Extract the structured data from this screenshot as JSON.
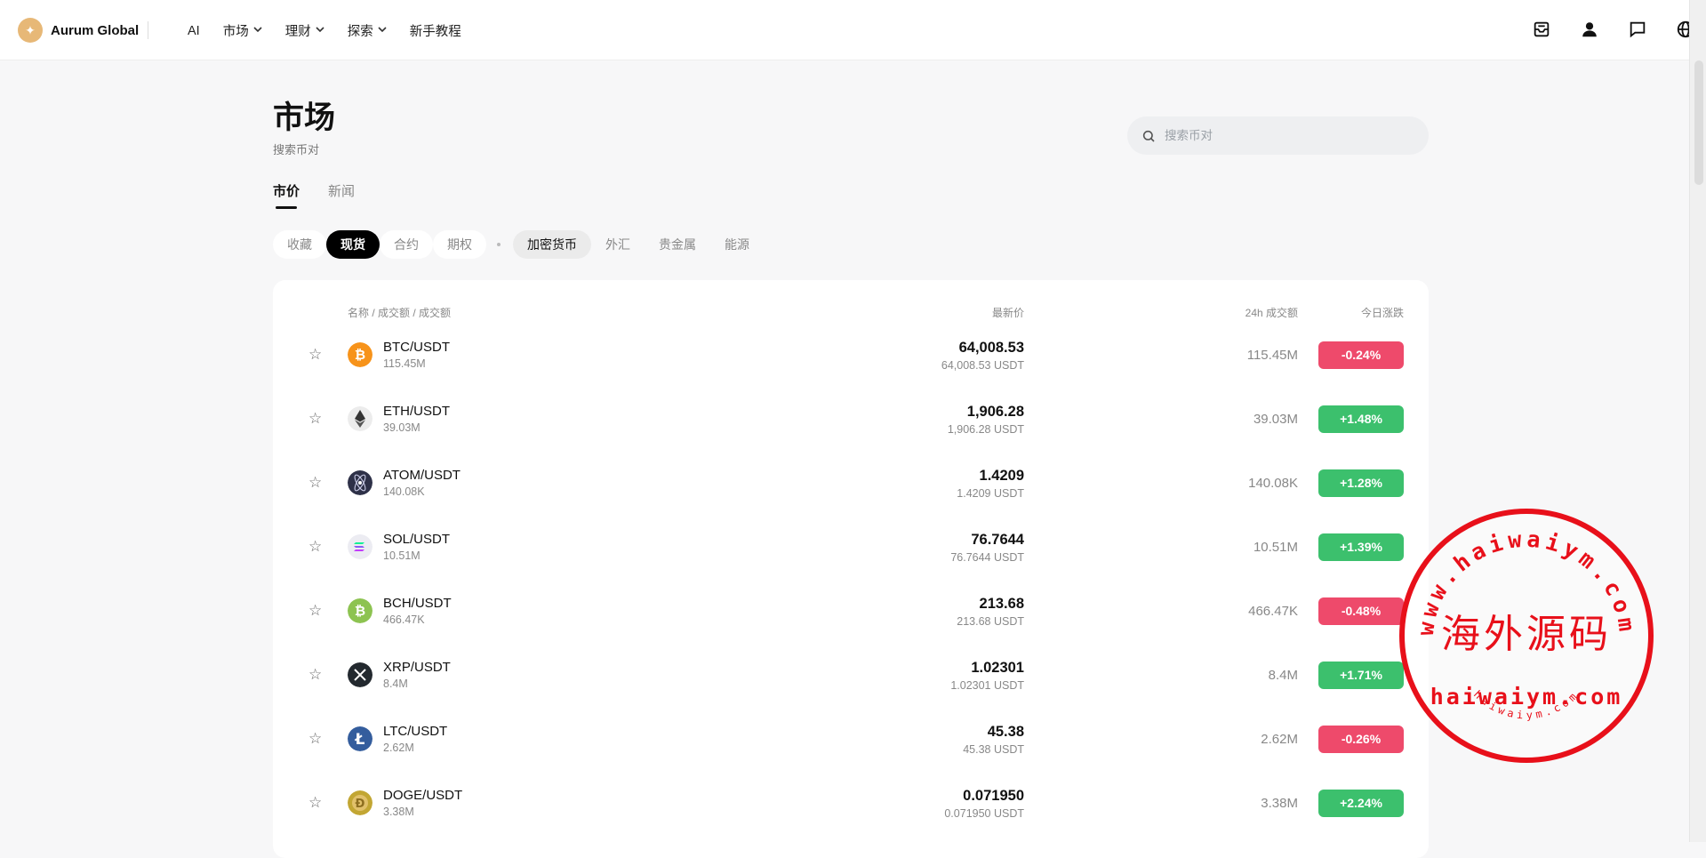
{
  "brand": {
    "name": "Aurum Global"
  },
  "nav": {
    "items": [
      {
        "label": "AI",
        "dropdown": false
      },
      {
        "label": "市场",
        "dropdown": true
      },
      {
        "label": "理财",
        "dropdown": true
      },
      {
        "label": "探索",
        "dropdown": true
      },
      {
        "label": "新手教程",
        "dropdown": false
      }
    ],
    "right_icons": [
      "inbox-icon",
      "user-icon",
      "chat-icon",
      "globe-icon"
    ]
  },
  "page": {
    "title": "市场",
    "subtitle": "搜索币对"
  },
  "search": {
    "placeholder": "搜索币对"
  },
  "tabs": [
    {
      "label": "市价",
      "active": true
    },
    {
      "label": "新闻",
      "active": false
    }
  ],
  "filters": {
    "type_chips": [
      {
        "label": "收藏",
        "state": "plain"
      },
      {
        "label": "现货",
        "state": "selected"
      },
      {
        "label": "合约",
        "state": "plain"
      },
      {
        "label": "期权",
        "state": "plain"
      }
    ],
    "category_chips": [
      {
        "label": "加密货币",
        "state": "selected"
      },
      {
        "label": "外汇",
        "state": "plain"
      },
      {
        "label": "贵金属",
        "state": "plain"
      },
      {
        "label": "能源",
        "state": "plain"
      }
    ]
  },
  "table": {
    "headers": {
      "name": "名称 / 成交额 / 成交额",
      "price": "最新价",
      "volume": "24h 成交额",
      "change": "今日涨跌"
    },
    "rows": [
      {
        "pair": "BTC/USDT",
        "vol_sub": "115.45M",
        "price": "64,008.53",
        "price_sub": "64,008.53 USDT",
        "volume": "115.45M",
        "change": "-0.24%",
        "up": false,
        "icon": "bitcoin-icon",
        "color": "#f7931a"
      },
      {
        "pair": "ETH/USDT",
        "vol_sub": "39.03M",
        "price": "1,906.28",
        "price_sub": "1,906.28 USDT",
        "volume": "39.03M",
        "change": "+1.48%",
        "up": true,
        "icon": "ethereum-icon",
        "color": "#ececec"
      },
      {
        "pair": "ATOM/USDT",
        "vol_sub": "140.08K",
        "price": "1.4209",
        "price_sub": "1.4209 USDT",
        "volume": "140.08K",
        "change": "+1.28%",
        "up": true,
        "icon": "cosmos-icon",
        "color": "#2e3148"
      },
      {
        "pair": "SOL/USDT",
        "vol_sub": "10.51M",
        "price": "76.7644",
        "price_sub": "76.7644 USDT",
        "volume": "10.51M",
        "change": "+1.39%",
        "up": true,
        "icon": "solana-icon",
        "color": "#ececf2"
      },
      {
        "pair": "BCH/USDT",
        "vol_sub": "466.47K",
        "price": "213.68",
        "price_sub": "213.68 USDT",
        "volume": "466.47K",
        "change": "-0.48%",
        "up": false,
        "icon": "bitcoin-cash-icon",
        "color": "#8dc351"
      },
      {
        "pair": "XRP/USDT",
        "vol_sub": "8.4M",
        "price": "1.02301",
        "price_sub": "1.02301 USDT",
        "volume": "8.4M",
        "change": "+1.71%",
        "up": true,
        "icon": "xrp-icon",
        "color": "#23292f"
      },
      {
        "pair": "LTC/USDT",
        "vol_sub": "2.62M",
        "price": "45.38",
        "price_sub": "45.38 USDT",
        "volume": "2.62M",
        "change": "-0.26%",
        "up": false,
        "icon": "litecoin-icon",
        "color": "#345d9d"
      },
      {
        "pair": "DOGE/USDT",
        "vol_sub": "3.38M",
        "price": "0.071950",
        "price_sub": "0.071950 USDT",
        "volume": "3.38M",
        "change": "+2.24%",
        "up": true,
        "icon": "dogecoin-icon",
        "color": "#c2a633"
      }
    ]
  },
  "colors": {
    "up": "#3cc06d",
    "down": "#ee4a6b",
    "brand": "#e7b877",
    "stamp": "#e8101a"
  },
  "watermark": {
    "top_text": "www.haiwaiym.com",
    "center_text": "海外源码",
    "bottom_text": "haiwaiym.com",
    "tiny_text": "haiwaiym.com"
  }
}
